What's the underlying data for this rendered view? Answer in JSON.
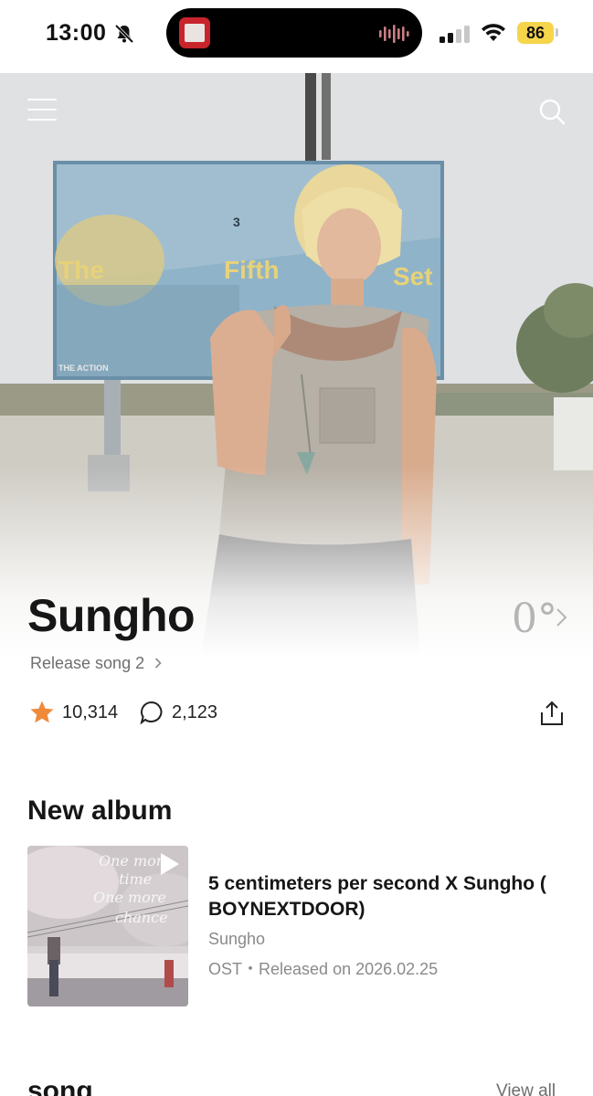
{
  "status_bar": {
    "time": "13:00",
    "battery": "86",
    "icons": [
      "bell-slash-icon",
      "signal-icon",
      "wifi-icon",
      "battery-icon"
    ]
  },
  "header": {
    "menu_icon": "hamburger-menu-icon",
    "search_icon": "search-icon"
  },
  "hero_billboard": {
    "text_left": "The",
    "text_mid": "Fifth",
    "text_right": "Set",
    "small_text": "THE ACTION",
    "number": "3"
  },
  "artist": {
    "name": "Sungho",
    "logo": "0°",
    "release_link": "Release song 2",
    "likes": "10,314",
    "comments": "2,123"
  },
  "new_album": {
    "section_title": "New album",
    "title": "5 centimeters per second X Sungho ( BOYNEXTDOOR)",
    "artist": "Sungho",
    "type": "OST",
    "separator": "・",
    "released": "Released on 2026.02.25",
    "cover_text": [
      "One more",
      "time",
      "One more",
      "chance"
    ]
  },
  "song_section": {
    "title": "song",
    "view_all": "View all"
  },
  "colors": {
    "accent_star": "#ef8a3a",
    "battery": "#f6d54b",
    "text_primary": "#161616",
    "text_secondary": "#8a8a8a"
  }
}
